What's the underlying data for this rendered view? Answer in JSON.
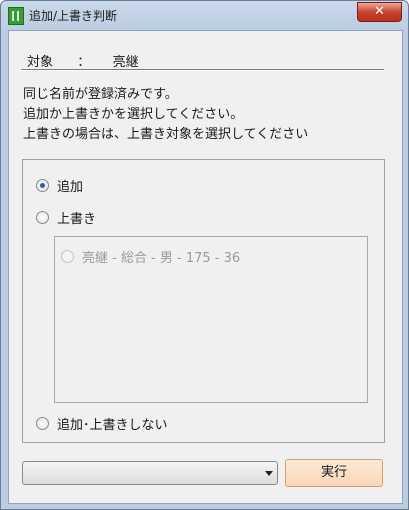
{
  "window": {
    "title": "追加/上書き判断",
    "close_label": "✕"
  },
  "target": {
    "label": "対象",
    "colon": "：",
    "value": "亮継"
  },
  "message": [
    "同じ名前が登録済みです。",
    "追加か上書きかを選択してください。",
    "上書きの場合は、上書き対象を選択してください"
  ],
  "options": {
    "add": {
      "label": "追加",
      "checked": true
    },
    "overwrite": {
      "label": "上書き",
      "checked": false
    },
    "none": {
      "label": "追加･上書きしない",
      "checked": false
    }
  },
  "candidates": [
    {
      "label": "亮継 - 総合 - 男 - 175 - 36",
      "enabled": false
    }
  ],
  "dropdown": {
    "value": ""
  },
  "buttons": {
    "execute": "実行"
  },
  "colors": {
    "accent_radio": "#2f5ea8",
    "execute_button": "#f8d7b7",
    "close_button": "#c7432f"
  }
}
